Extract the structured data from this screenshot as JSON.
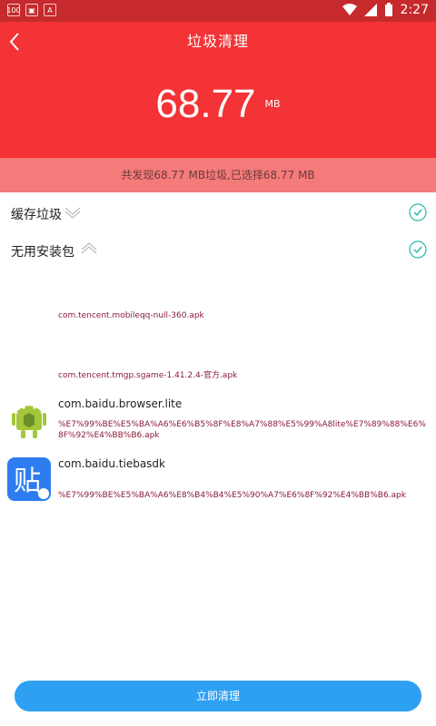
{
  "status_bar": {
    "time": "2:27",
    "left_icons": [
      "battery-100-icon",
      "image-icon",
      "a-icon"
    ],
    "right_icons": [
      "wifi-icon",
      "signal-icon",
      "battery-icon"
    ]
  },
  "header": {
    "title": "垃圾清理",
    "amount": "68.77",
    "unit": "MB",
    "color": "#f33336"
  },
  "summary": {
    "text": "共发现68.77 MB垃圾,已选择68.77 MB"
  },
  "categories": [
    {
      "label": "缓存垃圾",
      "expanded": false,
      "checked": true
    },
    {
      "label": "无用安装包",
      "expanded": true,
      "checked": true
    }
  ],
  "apks": [
    {
      "package": "",
      "file": "com.tencent.mobileqq-null-360.apk",
      "icon": ""
    },
    {
      "package": "",
      "file": "com.tencent.tmgp.sgame-1.41.2.4-官方.apk",
      "icon": ""
    },
    {
      "package": "com.baidu.browser.lite",
      "file": "%E7%99%BE%E5%BA%A6%E6%B5%8F%E8%A7%88%E5%99%A8lite%E7%89%88%E6%8F%92%E4%BB%B6.apk",
      "icon": "android-icon"
    },
    {
      "package": "com.baidu.tiebasdk",
      "file": "%E7%99%BE%E5%BA%A6%E8%B4%B4%E5%90%A7%E6%8F%92%E4%BB%B6.apk",
      "icon": "tieba-icon"
    }
  ],
  "button": {
    "label": "立即清理",
    "color": "#2ea0f2"
  }
}
